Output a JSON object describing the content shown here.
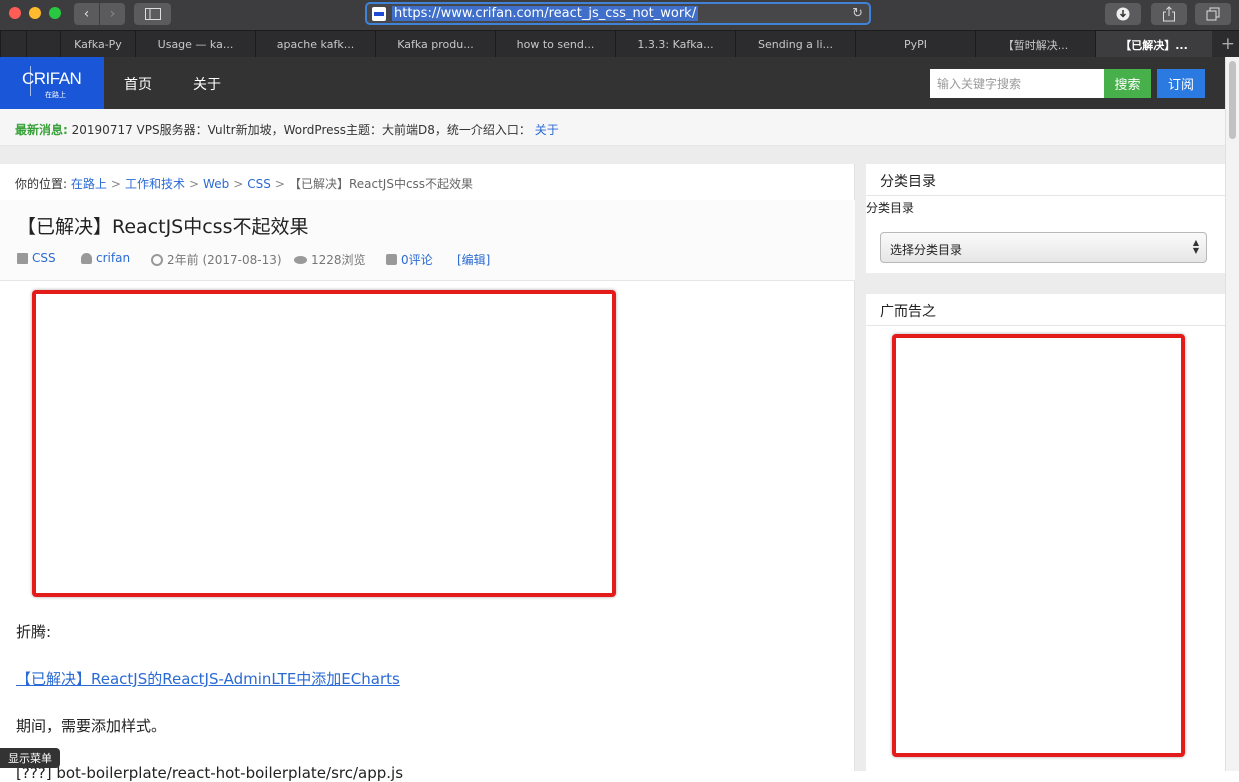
{
  "browser": {
    "url": "https://www.crifan.com/react_js_css_not_work/",
    "tabs": [
      {
        "label": "Kafka-Py"
      },
      {
        "label": "Usage — ka..."
      },
      {
        "label": "apache kafk..."
      },
      {
        "label": "Kafka produ..."
      },
      {
        "label": "how to send..."
      },
      {
        "label": "1.3.3: Kafka..."
      },
      {
        "label": "Sending a li..."
      },
      {
        "label": "PyPI"
      },
      {
        "label": "【暂时解决..."
      },
      {
        "label": "【已解决】..."
      }
    ],
    "back_icon": "‹",
    "forward_icon": "›",
    "reload_icon": "↻",
    "new_tab_icon": "+"
  },
  "site": {
    "logo": "CRIFAN",
    "logo_sub": "在路上",
    "nav": {
      "home": "首页",
      "about": "关于"
    },
    "search_placeholder": "输入关键字搜索",
    "search_button": "搜索",
    "subscribe_button": "订阅"
  },
  "news": {
    "label": "最新消息:",
    "text": "20190717 VPS服务器：Vultr新加坡，WordPress主题：大前端D8，统一介绍入口：",
    "link": "关于"
  },
  "breadcrumb": {
    "prefix": "你的位置:",
    "items": [
      "在路上",
      "工作和技术",
      "Web",
      "CSS"
    ],
    "current": "【已解决】ReactJS中css不起效果",
    "separator": ">"
  },
  "post": {
    "title": "【已解决】ReactJS中css不起效果",
    "meta": {
      "category": "CSS",
      "author": "crifan",
      "date": "2年前 (2017-08-13)",
      "views": "1228浏览",
      "comments": "0评论",
      "edit": "[编辑]"
    },
    "p1": "折腾:",
    "link": "【已解决】ReactJS的ReactJS-AdminLTE中添加ECharts",
    "p2": "期间，需要添加样式。",
    "partial_line": "[???] bot-boilerplate/react-hot-boilerplate/src/app.js"
  },
  "sidebar": {
    "category_title": "分类目录",
    "category_label": "分类目录",
    "category_select": "选择分类目录",
    "ad_title": "广而告之"
  },
  "show_menu": "显示菜单",
  "colors": {
    "brand_blue": "#1a57d8",
    "search_green": "#47b04b",
    "subscribe_blue": "#2a7ae2",
    "ad_border_red": "#e41b1b",
    "link_blue": "#2a6ad4"
  }
}
